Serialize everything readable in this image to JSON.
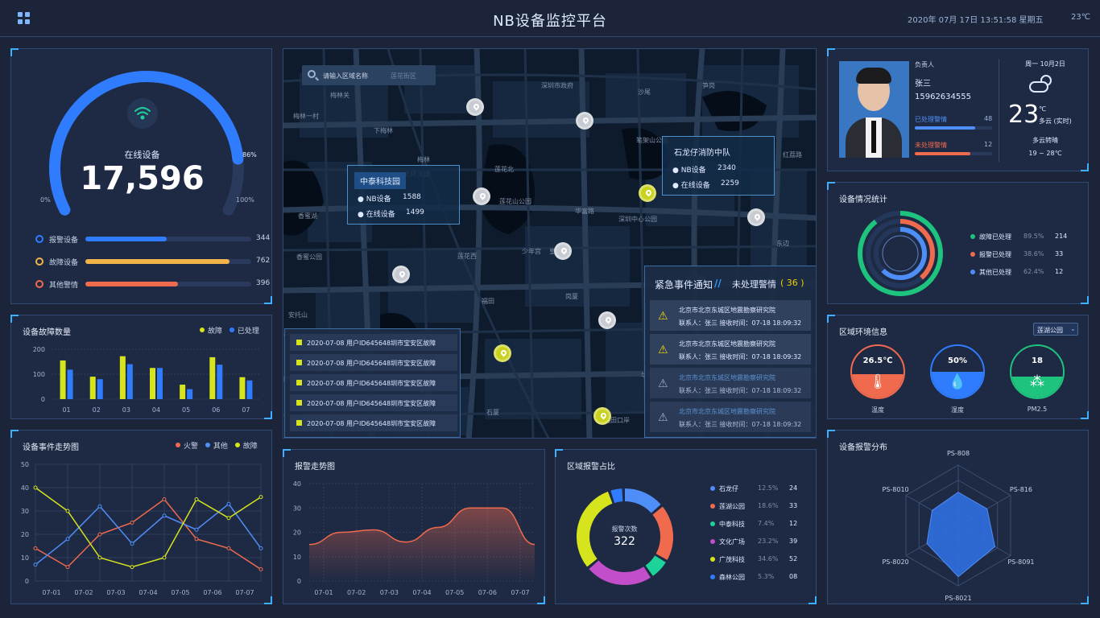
{
  "header": {
    "title": "NB设备监控平台",
    "datetime": "2020年 07月 17日 13:51:58 星期五",
    "temp": "23℃"
  },
  "online": {
    "label": "在线设备",
    "value": "17,596",
    "percent": 86,
    "pct_label": "86%",
    "min": "0%",
    "max": "100%"
  },
  "status_bars": [
    {
      "label": "报警设备",
      "value": "344",
      "fraction": 0.49,
      "color": "#2f7cff"
    },
    {
      "label": "故障设备",
      "value": "762",
      "fraction": 0.87,
      "color": "#f3b34b"
    },
    {
      "label": "其他警情",
      "value": "396",
      "fraction": 0.56,
      "color": "#f06a4e"
    }
  ],
  "fault_chart": {
    "title": "设备故障数量",
    "legend": [
      "故障",
      "已处理"
    ],
    "colors": [
      "#d6e41e",
      "#2f7cff"
    ],
    "categories": [
      "01",
      "02",
      "03",
      "04",
      "05",
      "06",
      "07"
    ],
    "yticks": [
      "200",
      "100",
      "0"
    ]
  },
  "event_chart": {
    "title": "设备事件走势图",
    "legend": [
      "火警",
      "其他",
      "故障"
    ],
    "colors": [
      "#f06a4e",
      "#4f8ef7",
      "#d6e41e"
    ],
    "categories": [
      "07-01",
      "07-02",
      "07-03",
      "07-04",
      "07-05",
      "07-06",
      "07-07"
    ],
    "yticks": [
      "50",
      "40",
      "30",
      "20",
      "10",
      "0"
    ]
  },
  "alarm_trend": {
    "title": "报警走势图",
    "categories": [
      "07-01",
      "07-02",
      "07-03",
      "07-04",
      "07-05",
      "07-06",
      "07-07"
    ],
    "yticks": [
      "40",
      "30",
      "20",
      "10",
      "0"
    ]
  },
  "region_share": {
    "title": "区域报警占比",
    "center_label": "报警次数",
    "center_value": "322",
    "items": [
      {
        "name": "石龙仔",
        "pct": "12.5%",
        "count": "24",
        "color": "#4f8ef7"
      },
      {
        "name": "莲湖公园",
        "pct": "18.6%",
        "count": "33",
        "color": "#f06a4e"
      },
      {
        "name": "中泰科技",
        "pct": "7.4%",
        "count": "12",
        "color": "#1ed39a"
      },
      {
        "name": "文化广场",
        "pct": "23.2%",
        "count": "39",
        "color": "#c24fc9"
      },
      {
        "name": "广茂科技",
        "pct": "34.6%",
        "count": "52",
        "color": "#d6e41e"
      },
      {
        "name": "森林公园",
        "pct": "5.3%",
        "count": "08",
        "color": "#2f7cff"
      }
    ]
  },
  "person": {
    "role": "负责人",
    "name": "张三",
    "phone": "15962634555",
    "handled_label": "已处理警情",
    "handled": "48",
    "unhandled_label": "未处理警情",
    "unhandled": "12"
  },
  "weather": {
    "date": "周一  10月2日",
    "temp": "23",
    "unit": "℃",
    "desc": "多云 (实时)",
    "forecast": "多云转晴",
    "range": "19 ~ 28℃"
  },
  "device_stats": {
    "title": "设备情况统计",
    "items": [
      {
        "label": "故障已处理",
        "pct": "89.5%",
        "count": "214",
        "color": "#1ec47d"
      },
      {
        "label": "报警已处理",
        "pct": "38.6%",
        "count": "33",
        "color": "#f06a4e"
      },
      {
        "label": "其他已处理",
        "pct": "62.4%",
        "count": "12",
        "color": "#4f8ef7"
      }
    ]
  },
  "env": {
    "title": "区域环境信息",
    "select": "莲湖公园",
    "items": [
      {
        "value": "26.5℃",
        "label": "温度",
        "color": "#f06a4e",
        "glyph": "🌡",
        "level": 0.45
      },
      {
        "value": "50%",
        "label": "湿度",
        "color": "#2f7cff",
        "glyph": "💧",
        "level": 0.5
      },
      {
        "value": "18",
        "label": "PM2.5",
        "color": "#1ec47d",
        "glyph": "⁂",
        "level": 0.4
      }
    ]
  },
  "radar": {
    "title": "设备报警分布",
    "axes": [
      "PS-808",
      "PS-816",
      "PS-8091",
      "PS-8021",
      "PS-8020",
      "PS-8010"
    ]
  },
  "map": {
    "search_placeholder": "请输入区域名称",
    "search_hint": "莲花街区",
    "callouts": [
      {
        "name": "中泰科技园",
        "rows": [
          {
            "k": "NB设备",
            "v": "1588"
          },
          {
            "k": "在线设备",
            "v": "1499"
          }
        ]
      },
      {
        "name": "石龙仔消防中队",
        "rows": [
          {
            "k": "NB设备",
            "v": "2340"
          },
          {
            "k": "在线设备",
            "v": "2259"
          }
        ]
      }
    ],
    "labels": [
      "梅林一村",
      "下梅林",
      "莲花山公园",
      "笔架山公园",
      "深圳中心公园",
      "香蜜湖",
      "莲花西",
      "福田",
      "深圳国际广场",
      "梅林关",
      "莲花北",
      "深圳市政府",
      "少年宫",
      "岗厦",
      "福田口岸",
      "红荔路",
      "东边",
      "北环大道",
      "香蜜公园",
      "车公庙",
      "竹子林",
      "安托山",
      "华富路",
      "华强北",
      "笋岗",
      "梅林",
      "皇岗村",
      "石厦",
      "新洲",
      "沙尾"
    ],
    "events": [
      "2020-07-08  用户ID645648圳市宝安区故障",
      "2020-07-08  用户ID645648圳市宝安区故障",
      "2020-07-08  用户ID645648圳市宝安区故障",
      "2020-07-08  用户ID645648圳市宝安区故障",
      "2020-07-08  用户ID645648圳市宝安区故障"
    ],
    "notice_title": "紧急事件通知",
    "notice_sub": "未处理警情",
    "notice_count": "( 36 )",
    "alarms": [
      {
        "addr": "北京市北京东城区地震勘察研究院",
        "contact": "联系人：张三    接收时间：07-18 18:09:32"
      },
      {
        "addr": "北京市北京东城区地震勘察研究院",
        "contact": "联系人：张三    接收时间：07-18 18:09:32"
      },
      {
        "addr": "北京市北京东城区地震勘察研究院",
        "contact": "联系人：张三    接收时间：07-18 18:09:32"
      },
      {
        "addr": "北京市北京东城区地震勘察研究院",
        "contact": "联系人：张三    接收时间：07-18 18:09:32"
      }
    ]
  },
  "chart_data": [
    {
      "type": "bar",
      "title": "设备故障数量",
      "categories": [
        "01",
        "02",
        "03",
        "04",
        "05",
        "06",
        "07"
      ],
      "ylim": [
        0,
        200
      ],
      "series": [
        {
          "name": "故障",
          "values": [
            155,
            90,
            172,
            125,
            58,
            168,
            88
          ]
        },
        {
          "name": "已处理",
          "values": [
            118,
            80,
            140,
            125,
            40,
            138,
            75
          ]
        }
      ]
    },
    {
      "type": "line",
      "title": "设备事件走势图",
      "categories": [
        "07-01",
        "07-02",
        "07-03",
        "07-04",
        "07-05",
        "07-06",
        "07-07"
      ],
      "ylim": [
        0,
        50
      ],
      "series": [
        {
          "name": "火警",
          "values": [
            14,
            6,
            20,
            25,
            35,
            18,
            14,
            5
          ]
        },
        {
          "name": "其他",
          "values": [
            7,
            18,
            32,
            16,
            28,
            22,
            33,
            14
          ]
        },
        {
          "name": "故障",
          "values": [
            40,
            30,
            10,
            6,
            10,
            35,
            27,
            36
          ]
        }
      ]
    },
    {
      "type": "area",
      "title": "报警走势图",
      "categories": [
        "07-01",
        "07-02",
        "07-03",
        "07-04",
        "07-05",
        "07-06",
        "07-07"
      ],
      "ylim": [
        0,
        40
      ],
      "series": [
        {
          "values": [
            15,
            20,
            21,
            16,
            22,
            30,
            30,
            15
          ]
        }
      ]
    },
    {
      "type": "pie",
      "title": "区域报警占比",
      "categories": [
        "石龙仔",
        "莲湖公园",
        "中泰科技",
        "文化广场",
        "广茂科技",
        "森林公园"
      ],
      "values": [
        24,
        33,
        12,
        39,
        52,
        8
      ]
    },
    {
      "type": "radar",
      "title": "设备报警分布",
      "categories": [
        "PS-808",
        "PS-816",
        "PS-8091",
        "PS-8021",
        "PS-8020",
        "PS-8010"
      ],
      "values": [
        0.55,
        0.55,
        0.7,
        0.85,
        0.6,
        0.5
      ]
    }
  ]
}
